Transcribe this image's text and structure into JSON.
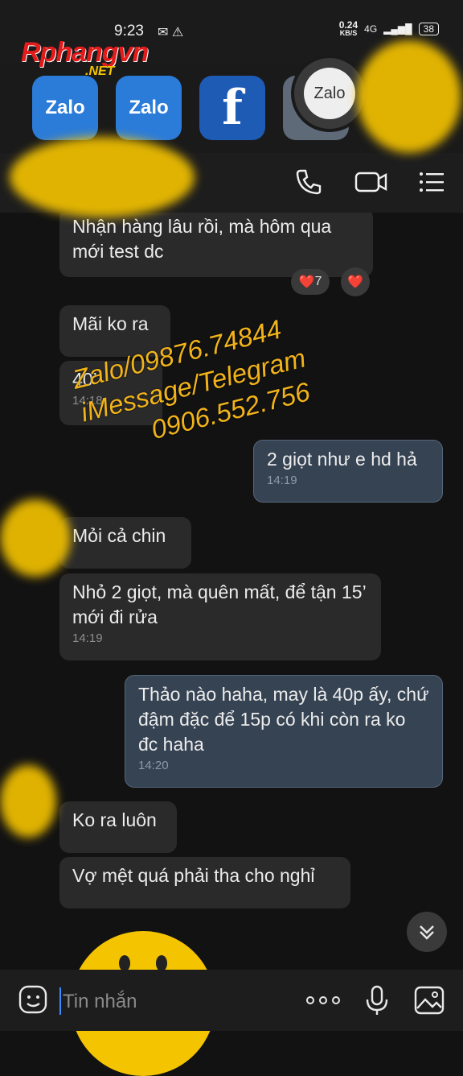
{
  "status": {
    "time": "9:23",
    "speed_value": "0.24",
    "speed_unit": "KB/S",
    "network": "4G",
    "battery": "38"
  },
  "logo": {
    "main": "Rphangvn",
    "sub": ".NET"
  },
  "apps": [
    {
      "name": "Zalo"
    },
    {
      "name": "Zalo"
    },
    {
      "name": "f"
    },
    {
      "name": "Zalo"
    }
  ],
  "messages": [
    {
      "from": "other",
      "text": "Nhận hàng lâu rồi, mà hôm qua mới test dc",
      "reactions": [
        {
          "emoji": "❤️",
          "count": "7"
        },
        {
          "emoji": "❤️",
          "count": ""
        }
      ]
    },
    {
      "from": "other",
      "text": "Mãi ko ra"
    },
    {
      "from": "other",
      "text": "40’",
      "time": "14:18"
    },
    {
      "from": "me",
      "text": "2 giọt như e hd hả",
      "time": "14:19"
    },
    {
      "from": "other",
      "text": "Mỏi cả chin"
    },
    {
      "from": "other",
      "text": "Nhỏ 2 giọt, mà quên mất, để tận 15’ mới đi rửa",
      "time": "14:19"
    },
    {
      "from": "me",
      "text": "Thảo nào haha, may là 40p ấy, chứ đậm đặc để 15p có khi còn ra ko đc haha",
      "time": "14:20"
    },
    {
      "from": "other",
      "text": "Ko ra luôn"
    },
    {
      "from": "other",
      "text": "Vợ mệt quá phải tha cho nghỉ"
    }
  ],
  "watermark": {
    "line1": "Zalo/09876.74844",
    "line2": "iMessage/Telegram",
    "line3": "0906.552.756"
  },
  "input": {
    "placeholder": "Tin nhắn"
  },
  "icons": [
    "messenger-icon",
    "warning-icon",
    "signal-icon",
    "phone-icon",
    "video-icon",
    "menu-icon",
    "chevron-double-down-icon",
    "emoji-icon",
    "more-icon",
    "mic-icon",
    "image-icon"
  ],
  "colors": {
    "background": "#121212",
    "incoming_bubble": "#2a2a2b",
    "outgoing_bubble": "#364353",
    "watermark": "#f1b31a",
    "censor": "#f6c400"
  }
}
